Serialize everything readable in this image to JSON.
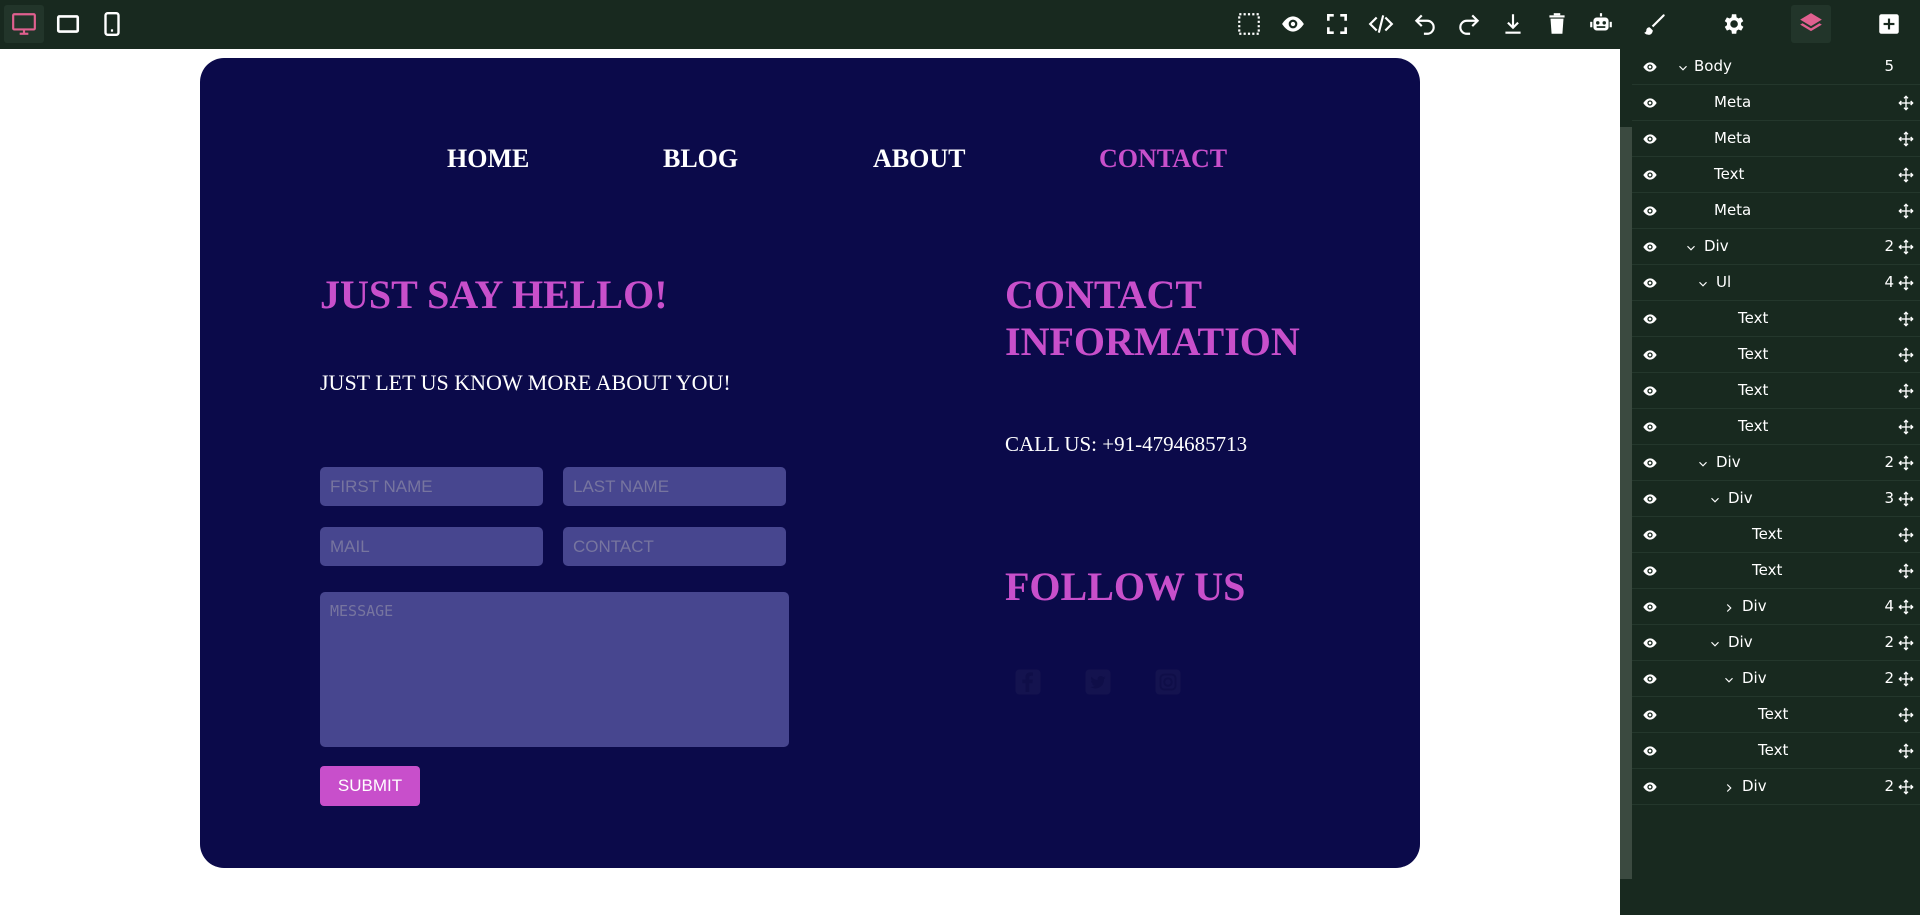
{
  "toolbar": {
    "devices": [
      "desktop-icon",
      "tablet-icon",
      "mobile-icon"
    ],
    "actions": [
      "select-area-icon",
      "preview-icon",
      "fullscreen-icon",
      "code-icon",
      "undo-icon",
      "redo-icon",
      "download-icon",
      "trash-icon",
      "robot-icon"
    ],
    "panels": [
      "brush-icon",
      "gear-icon",
      "layers-icon",
      "add-block-icon"
    ],
    "accent": "#e0608f"
  },
  "page": {
    "nav": [
      "HOME",
      "BLOG",
      "ABOUT",
      "CONTACT"
    ],
    "active_nav": "CONTACT",
    "hello_title": "JUST SAY HELLO!",
    "hello_subtitle": "JUST LET US KNOW MORE ABOUT YOU!",
    "form": {
      "first_name_placeholder": "FIRST NAME",
      "last_name_placeholder": "LAST NAME",
      "mail_placeholder": "MAIL",
      "contact_placeholder": "CONTACT",
      "message_placeholder": "MESSAGE",
      "submit_label": "SUBMIT"
    },
    "contact_title": "CONTACT INFORMATION",
    "call_us": "CALL US: +91-4794685713",
    "follow_title": "FOLLOW US",
    "social_icons": [
      "facebook-icon",
      "twitter-icon",
      "instagram-icon"
    ],
    "colors": {
      "card_bg": "#0b0a4a",
      "accent": "#c84fcb",
      "field_bg": "#47468f"
    }
  },
  "layers": [
    {
      "name": "Body",
      "count": "5",
      "caret": "down",
      "depth": 0
    },
    {
      "name": "Meta",
      "count": "",
      "caret": "",
      "depth": 1
    },
    {
      "name": "Meta",
      "count": "",
      "caret": "",
      "depth": 1
    },
    {
      "name": "Text",
      "count": "",
      "caret": "",
      "depth": 1
    },
    {
      "name": "Meta",
      "count": "",
      "caret": "",
      "depth": 1
    },
    {
      "name": "Div",
      "count": "2",
      "caret": "down",
      "depth": 1
    },
    {
      "name": "Ul",
      "count": "4",
      "caret": "down",
      "depth": 2
    },
    {
      "name": "Text",
      "count": "",
      "caret": "",
      "depth": 3
    },
    {
      "name": "Text",
      "count": "",
      "caret": "",
      "depth": 3
    },
    {
      "name": "Text",
      "count": "",
      "caret": "",
      "depth": 3
    },
    {
      "name": "Text",
      "count": "",
      "caret": "",
      "depth": 3
    },
    {
      "name": "Div",
      "count": "2",
      "caret": "down",
      "depth": 2
    },
    {
      "name": "Div",
      "count": "3",
      "caret": "down",
      "depth": 3
    },
    {
      "name": "Text",
      "count": "",
      "caret": "",
      "depth": 4
    },
    {
      "name": "Text",
      "count": "",
      "caret": "",
      "depth": 4
    },
    {
      "name": "Div",
      "count": "4",
      "caret": "right",
      "depth": 4
    },
    {
      "name": "Div",
      "count": "2",
      "caret": "down",
      "depth": 3
    },
    {
      "name": "Div",
      "count": "2",
      "caret": "down",
      "depth": 4
    },
    {
      "name": "Text",
      "count": "",
      "caret": "",
      "depth": 5
    },
    {
      "name": "Text",
      "count": "",
      "caret": "",
      "depth": 5
    },
    {
      "name": "Div",
      "count": "2",
      "caret": "right",
      "depth": 4
    }
  ]
}
